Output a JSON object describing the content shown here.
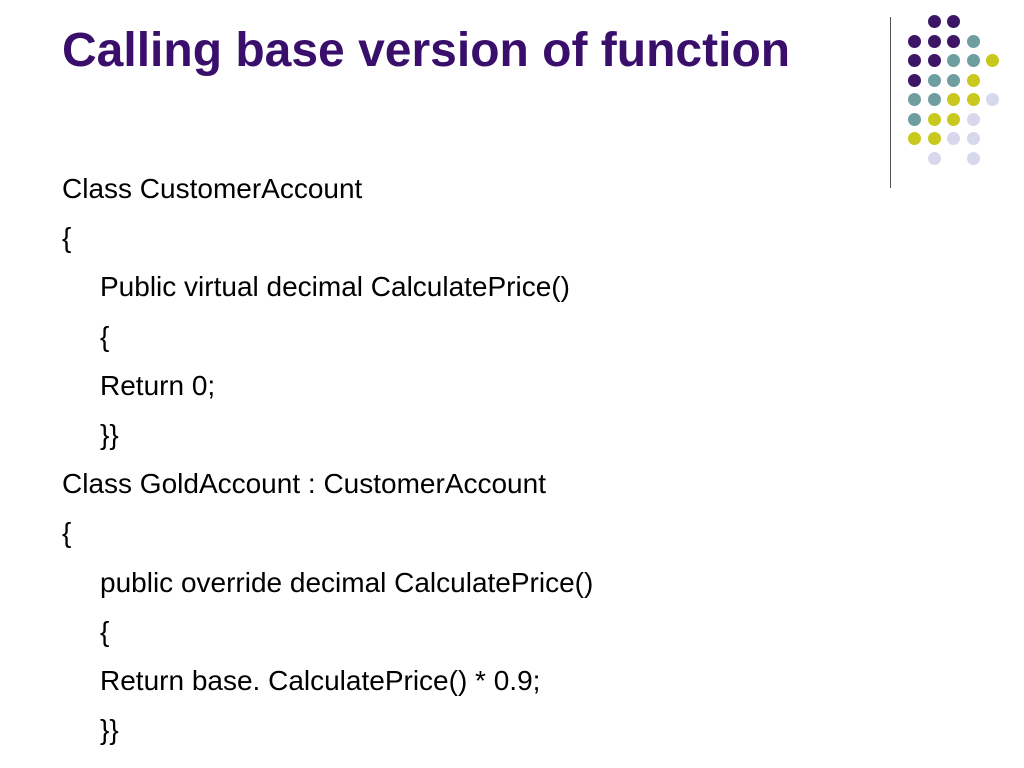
{
  "slide": {
    "title": "Calling base version of function",
    "lines": [
      {
        "text": "Class CustomerAccount",
        "indent": false
      },
      {
        "text": "{",
        "indent": false
      },
      {
        "text": "Public virtual decimal CalculatePrice()",
        "indent": true
      },
      {
        "text": "{",
        "indent": true
      },
      {
        "text": "Return 0;",
        "indent": true
      },
      {
        "text": "}}",
        "indent": true
      },
      {
        "text": "Class GoldAccount : CustomerAccount",
        "indent": false
      },
      {
        "text": "{",
        "indent": false
      },
      {
        "text": "public override decimal CalculatePrice()",
        "indent": true
      },
      {
        "text": "{",
        "indent": true
      },
      {
        "text": "Return base. CalculatePrice() * 0.9;",
        "indent": true
      },
      {
        "text": "}}",
        "indent": true
      }
    ]
  },
  "theme": {
    "title_color": "#3a0f6b",
    "dot_colors": {
      "purple": "#3d1766",
      "teal": "#6f9ea0",
      "yellow": "#c8c81e",
      "lavender": "#d8d8ec"
    }
  }
}
